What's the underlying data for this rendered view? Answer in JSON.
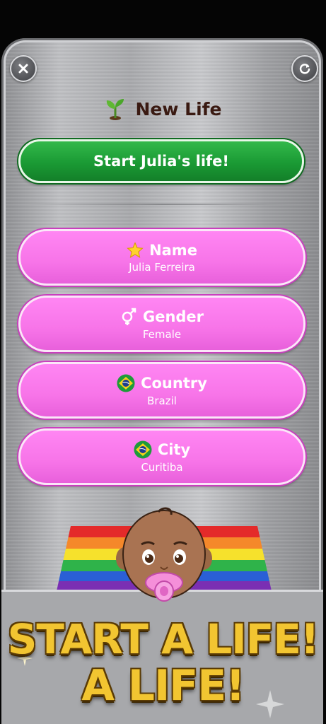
{
  "header": {
    "close_icon": "close-icon",
    "refresh_icon": "refresh-icon",
    "title_icon": "seedling-icon",
    "title": "New Life"
  },
  "start_button": {
    "label": "Start Julia's life!"
  },
  "options": [
    {
      "icon": "star-icon",
      "title": "Name",
      "value": "Julia Ferreira"
    },
    {
      "icon": "gender-icon",
      "title": "Gender",
      "value": "Female"
    },
    {
      "icon": "brazil-flag-icon",
      "title": "Country",
      "value": "Brazil"
    },
    {
      "icon": "brazil-flag-icon",
      "title": "City",
      "value": "Curitiba"
    }
  ],
  "promo": {
    "line1": "START A LIFE!",
    "line2": "A LIFE!",
    "baby_icon": "baby-with-pacifier-icon",
    "flag_icon": "rainbow-flag-icon"
  },
  "colors": {
    "start_button": "#1a9a34",
    "option_pink": "#f774e8",
    "banner_gold": "#f2c531",
    "title_text": "#3a1a12"
  }
}
